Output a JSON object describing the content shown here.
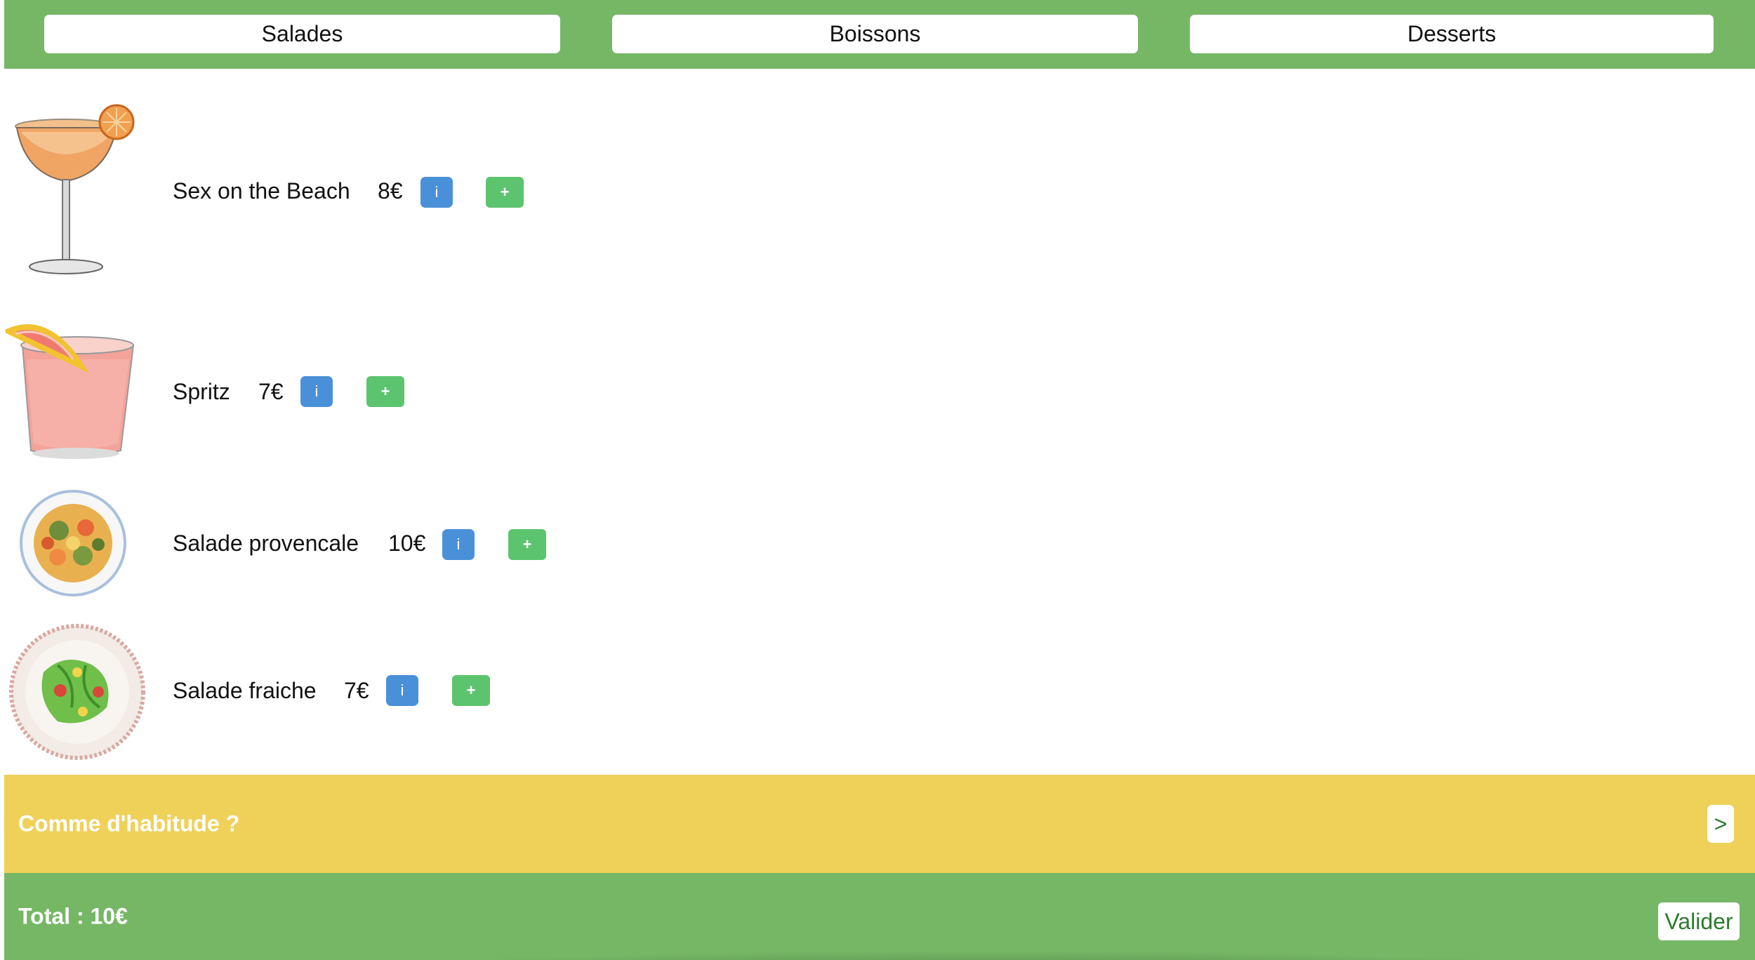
{
  "tabs": [
    {
      "label": "Salades"
    },
    {
      "label": "Boissons"
    },
    {
      "label": "Desserts"
    }
  ],
  "items": [
    {
      "name": "Sex on the Beach",
      "price": "8€",
      "info_label": "i",
      "add_label": "+",
      "image": "cocktail-coupe-image"
    },
    {
      "name": "Spritz",
      "price": "7€",
      "info_label": "i",
      "add_label": "+",
      "image": "spritz-glass-image"
    },
    {
      "name": "Salade provencale",
      "price": "10€",
      "info_label": "i",
      "add_label": "+",
      "image": "provencal-salad-plate-image"
    },
    {
      "name": "Salade fraiche",
      "price": "7€",
      "info_label": "i",
      "add_label": "+",
      "image": "fresh-salad-plate-image"
    }
  ],
  "habit": {
    "label": "Comme d'habitude ?",
    "button_label": ">"
  },
  "footer": {
    "total_label": "Total : 10€",
    "validate_label": "Valider"
  },
  "colors": {
    "green_bar": "#76b766",
    "yellow_banner": "#efd15a",
    "info_blue": "#4a90d9",
    "add_green": "#5cc46e"
  }
}
